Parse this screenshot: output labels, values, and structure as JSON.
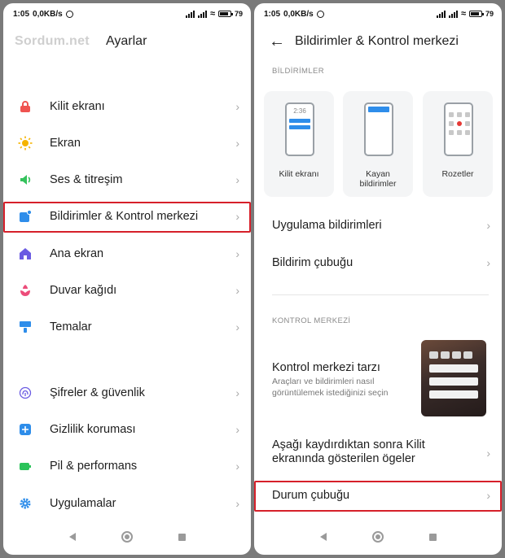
{
  "status": {
    "time": "1:05",
    "speed": "0,0KB/s",
    "battery": "79"
  },
  "left": {
    "brand": "Sordum.net",
    "title": "Ayarlar",
    "items": [
      {
        "label": "Kilit ekranı",
        "icon": "lock-icon",
        "color": "#ef5350"
      },
      {
        "label": "Ekran",
        "icon": "sun-icon",
        "color": "#f5b400"
      },
      {
        "label": "Ses & titreşim",
        "icon": "speaker-icon",
        "color": "#34c25c"
      },
      {
        "label": "Bildirimler & Kontrol merkezi",
        "icon": "notification-icon",
        "color": "#2e8dea"
      },
      {
        "label": "Ana ekran",
        "icon": "home-icon",
        "color": "#6a5be2"
      },
      {
        "label": "Duvar kağıdı",
        "icon": "flower-icon",
        "color": "#ec4c7a"
      },
      {
        "label": "Temalar",
        "icon": "brush-icon",
        "color": "#2e8dea"
      },
      {
        "label": "Şifreler & güvenlik",
        "icon": "fingerprint-icon",
        "color": "#6a5be2"
      },
      {
        "label": "Gizlilik koruması",
        "icon": "privacy-icon",
        "color": "#2e8dea"
      },
      {
        "label": "Pil & performans",
        "icon": "battery-icon",
        "color": "#2bc35a"
      },
      {
        "label": "Uygulamalar",
        "icon": "gear-icon",
        "color": "#2e8dea"
      }
    ]
  },
  "right": {
    "title": "Bildirimler & Kontrol merkezi",
    "section1": "BİLDİRİMLER",
    "cards": [
      {
        "label": "Kilit ekranı",
        "mock_time": "2:36"
      },
      {
        "label": "Kayan bildirimler"
      },
      {
        "label": "Rozetler"
      }
    ],
    "items1": [
      "Uygulama bildirimleri",
      "Bildirim çubuğu"
    ],
    "section2": "KONTROL MERKEZİ",
    "control_style": {
      "title": "Kontrol merkezi tarzı",
      "subtitle": "Araçları ve bildirimleri nasıl görüntülemek istediğinizi seçin"
    },
    "lockscreen_item": "Aşağı kaydırdıktan sonra Kilit ekranında gösterilen ögeler",
    "status_bar_item": "Durum çubuğu"
  }
}
